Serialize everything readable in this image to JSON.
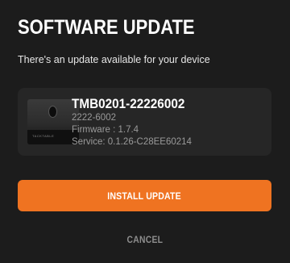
{
  "dialog": {
    "title": "SOFTWARE UPDATE",
    "subtitle": "There's an update available for your device"
  },
  "device": {
    "image_icon": "device-icon",
    "brand_mark": "TACKTABLE",
    "name": "TMB0201-22226002",
    "model": "2222-6002",
    "firmware": "Firmware : 1.7.4",
    "service": "Service: 0.1.26-C28EE60214"
  },
  "actions": {
    "install_label": "INSTALL UPDATE",
    "cancel_label": "CANCEL"
  },
  "colors": {
    "background": "#1c1c1c",
    "card": "#262626",
    "accent": "#ef7321",
    "muted_text": "#9a9a9a"
  }
}
